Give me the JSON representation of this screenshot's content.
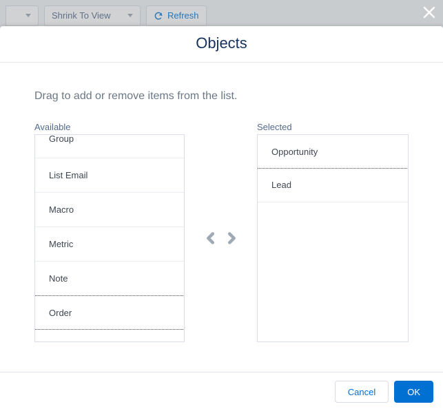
{
  "toolbar": {
    "zoom_label": "Shrink To View",
    "refresh_label": "Refresh"
  },
  "modal": {
    "title": "Objects",
    "instructions": "Drag to add or remove items from the list.",
    "available_label": "Available",
    "selected_label": "Selected",
    "available_items": [
      "Group",
      "List Email",
      "Macro",
      "Metric",
      "Note",
      "Order"
    ],
    "selected_items": [
      "Opportunity",
      "Lead"
    ],
    "cancel_label": "Cancel",
    "ok_label": "OK"
  }
}
